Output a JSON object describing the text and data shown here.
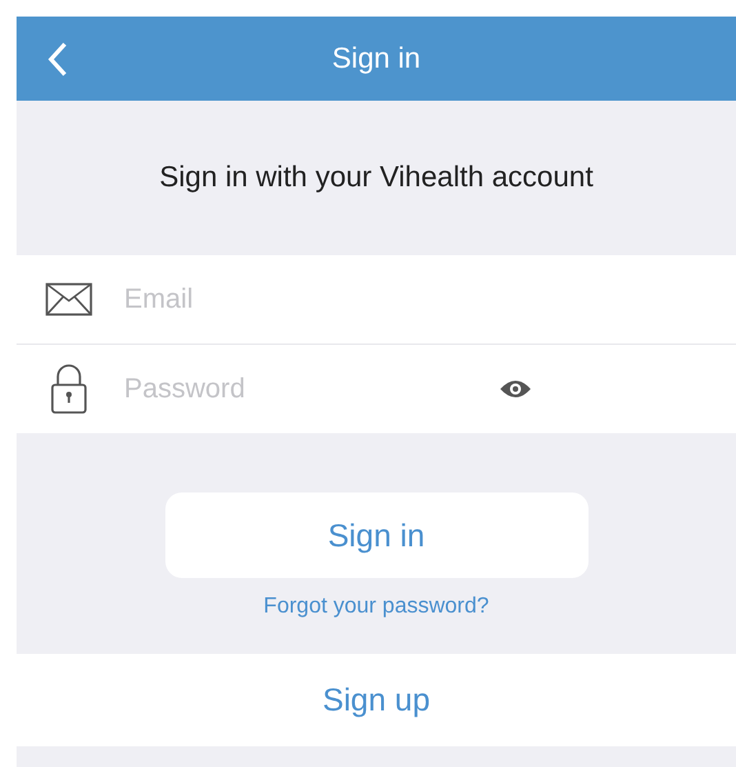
{
  "nav_bar": {
    "title": "Sign in"
  },
  "heading": "Sign in with your Vihealth account",
  "fields": [
    {
      "kind": "email",
      "placeholder": "Email"
    },
    {
      "kind": "password",
      "placeholder": "Password"
    }
  ],
  "sign_in_button": "Sign in",
  "forgot_link": "Forgot your password?",
  "sign_up_button": "Sign up"
}
